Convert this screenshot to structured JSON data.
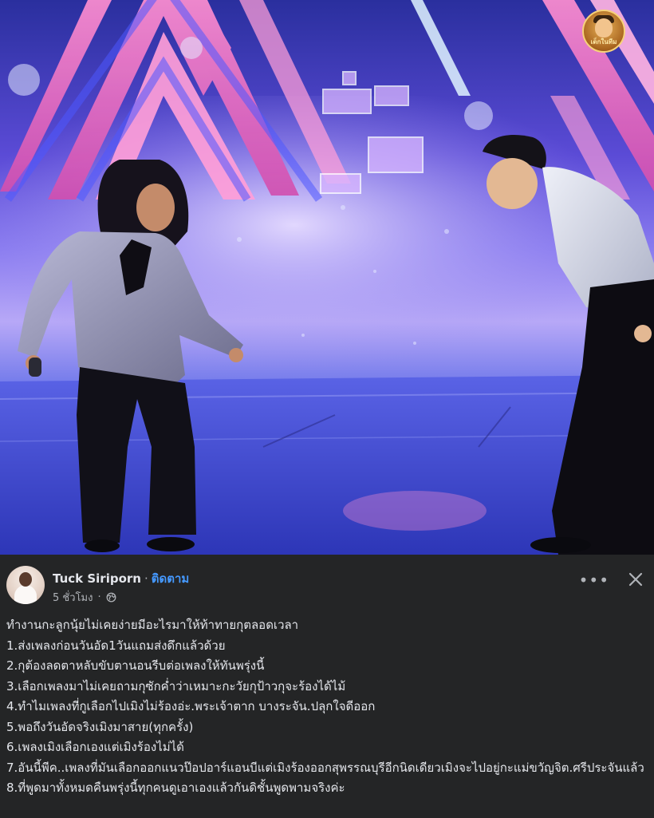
{
  "watermark": {
    "text": "เด็กในทีม"
  },
  "post": {
    "author": "Tuck Siriporn",
    "separator": "·",
    "follow_label": "ติดตาม",
    "time": "5 ชั่วโมง",
    "time_separator": "·",
    "more_icon": "more-horizontal-icon",
    "close_icon": "close-icon",
    "privacy_icon": "globe-icon",
    "lines": [
      "ทำงานกะลูกนุ้ยไม่เคยง่ายมีอะไรมาให้ท้าทายกุตลอดเวลา",
      "1.ส่งเพลงก่อนวันอัด1วันแถมส่งดึกแล้วด้วย",
      "2.กุต้องลดตาหลับขับตานอนรีบต่อเพลงให้ทันพรุ่งนี้",
      "3.เลือกเพลงมาไม่เคยถามกุซักค่ำว่าเหมาะกะวัยกุป้าวกุจะร้องได้ไม้",
      "4.ทำไมเพลงที่กูเลือกไปเมิงไม่ร้องอ่ะ.พระเจ้าตาก บางระจัน.ปลุกใจดีออก",
      "5.พอถึงวันอัดจริงเมิงมาสาย(ทุกครั้ง)",
      "6.เพลงเมิงเลือกเองแต่เมิงร้องไม่ได้",
      "7.อันนี้พีค..เพลงที่มันเลือกออกแนวป๊อปอาร์แอนบีแต่เมิงร้องออกสุพรรณบุรีอีกนิดเดียวเมิงจะไปอยู่กะแม่ขวัญจิต.ศรีประจันแล้ว",
      "8.ที่พูดมาทั้งหมดคืนพรุ่งนี้ทุกคนดูเอาเองแล้วกันดิชั้นพูดพามจริงค่ะ"
    ]
  },
  "colors": {
    "background": "#242526",
    "text": "#e4e6eb",
    "muted": "#b0b3b8",
    "link": "#4599ff"
  }
}
